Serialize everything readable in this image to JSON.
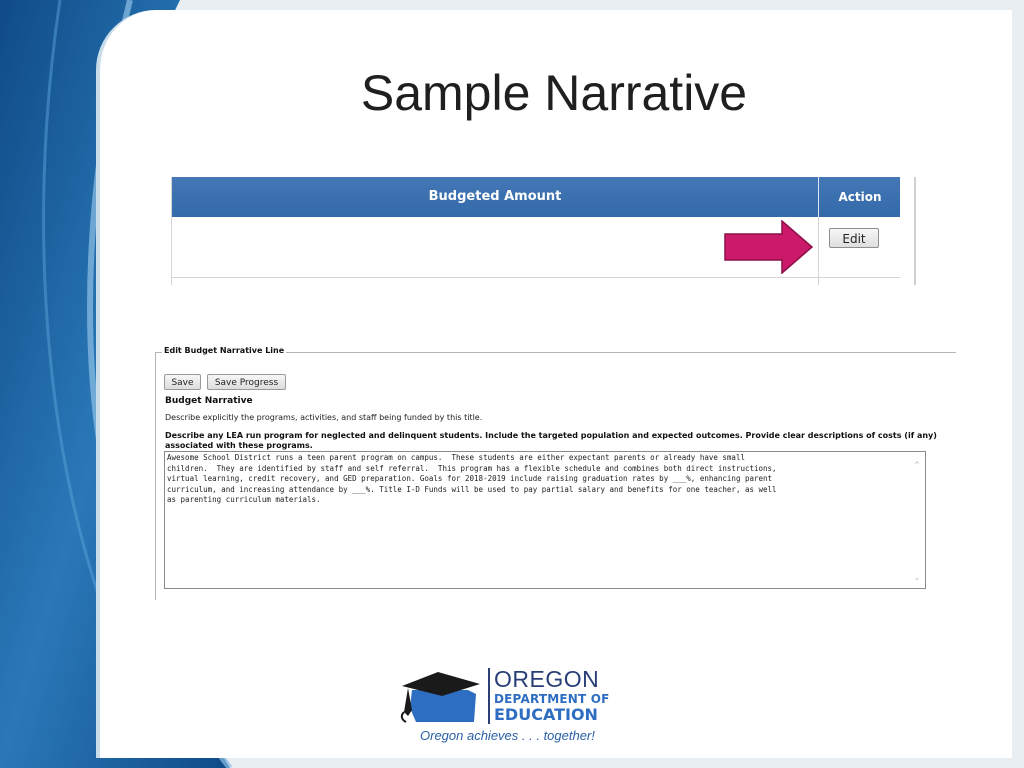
{
  "slide": {
    "title": "Sample Narrative"
  },
  "budget_table": {
    "headers": {
      "budgeted_amount": "Budgeted Amount",
      "action": "Action"
    },
    "edit_label": "Edit"
  },
  "narrative_form": {
    "legend": "Edit Budget Narrative Line",
    "save_label": "Save",
    "save_progress_label": "Save Progress",
    "heading": "Budget Narrative",
    "description": "Describe explicitly the programs, activities, and staff being funded by this title.",
    "prompt": "Describe any LEA run program for neglected and delinquent students. Include the targeted population and expected outcomes. Provide clear descriptions of costs (if any) associated with these programs.",
    "text": "Awesome School District runs a teen parent program on campus.  These students are either expectant parents or already have small\nchildren.  They are identified by staff and self referral.  This program has a flexible schedule and combines both direct instructions,\nvirtual learning, credit recovery, and GED preparation. Goals for 2018-2019 include raising graduation rates by ___%, enhancing parent\ncurriculum, and increasing attendance by ___%. Title I-D Funds will be used to pay partial salary and benefits for one teacher, as well\nas parenting curriculum materials."
  },
  "logo": {
    "line1": "OREGON",
    "line2": "DEPARTMENT OF",
    "line3": "EDUCATION",
    "tagline": "Oregon achieves . . . together!"
  },
  "icons": {
    "arrow": "right-arrow-icon",
    "scroll_up": "chevron-up-icon",
    "scroll_down": "chevron-down-icon",
    "logo_mark": "graduation-cap-oregon-icon"
  },
  "colors": {
    "table_header": "#3b6fb0",
    "arrow": "#cc1a6a",
    "slide_blue": "#1f5d9c",
    "logo_blue": "#2e6ec2",
    "logo_navy": "#2a3f78"
  }
}
